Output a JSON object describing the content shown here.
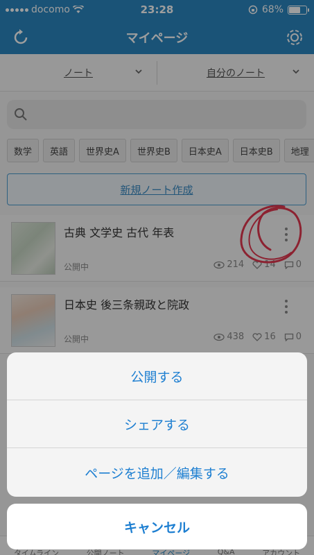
{
  "status": {
    "carrier": "docomo",
    "time": "23:28",
    "battery": "68%",
    "battery_level": 0.68
  },
  "header": {
    "title": "マイページ",
    "left_icon": "refresh-icon",
    "right_icon": "gear-icon"
  },
  "filters": {
    "type": "ノート",
    "scope": "自分のノート"
  },
  "search": {
    "placeholder": ""
  },
  "chips": [
    "数学",
    "英語",
    "世界史A",
    "世界史B",
    "日本史A",
    "日本史B",
    "地理"
  ],
  "new_note_label": "新規ノート作成",
  "notes": [
    {
      "title": "古典 文学史 古代 年表",
      "status": "公開中",
      "views": "214",
      "likes": "14",
      "comments": "0"
    },
    {
      "title": "日本史 後三条親政と院政",
      "status": "公開中",
      "views": "438",
      "likes": "16",
      "comments": "0"
    }
  ],
  "tabbar": [
    "タイムライン",
    "公開ノート",
    "マイページ",
    "Q&A",
    "アカウント"
  ],
  "action_sheet": {
    "items": [
      "公開する",
      "シェアする",
      "ページを追加／編集する"
    ],
    "cancel": "キャンセル"
  },
  "colors": {
    "primary": "#2b87c0",
    "action": "#1e7fd1"
  }
}
